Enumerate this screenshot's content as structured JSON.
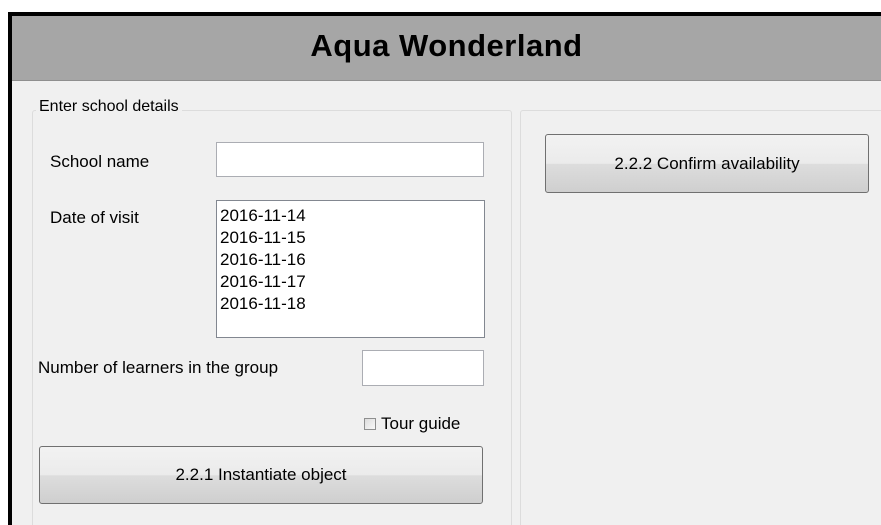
{
  "window": {
    "title": "Aqua Wonderland"
  },
  "school_group": {
    "caption": "Enter school details",
    "school_name_label": "School name",
    "school_name_value": "",
    "date_label": "Date of visit",
    "dates": [
      "2016-11-14",
      "2016-11-15",
      "2016-11-16",
      "2016-11-17",
      "2016-11-18"
    ],
    "learners_label": "Number of learners in the group",
    "learners_value": "",
    "tour_guide_label": "Tour guide",
    "tour_guide_checked": false,
    "instantiate_button": "2.2.1 Instantiate object"
  },
  "right_panel": {
    "confirm_button": "2.2.2 Confirm availability"
  }
}
